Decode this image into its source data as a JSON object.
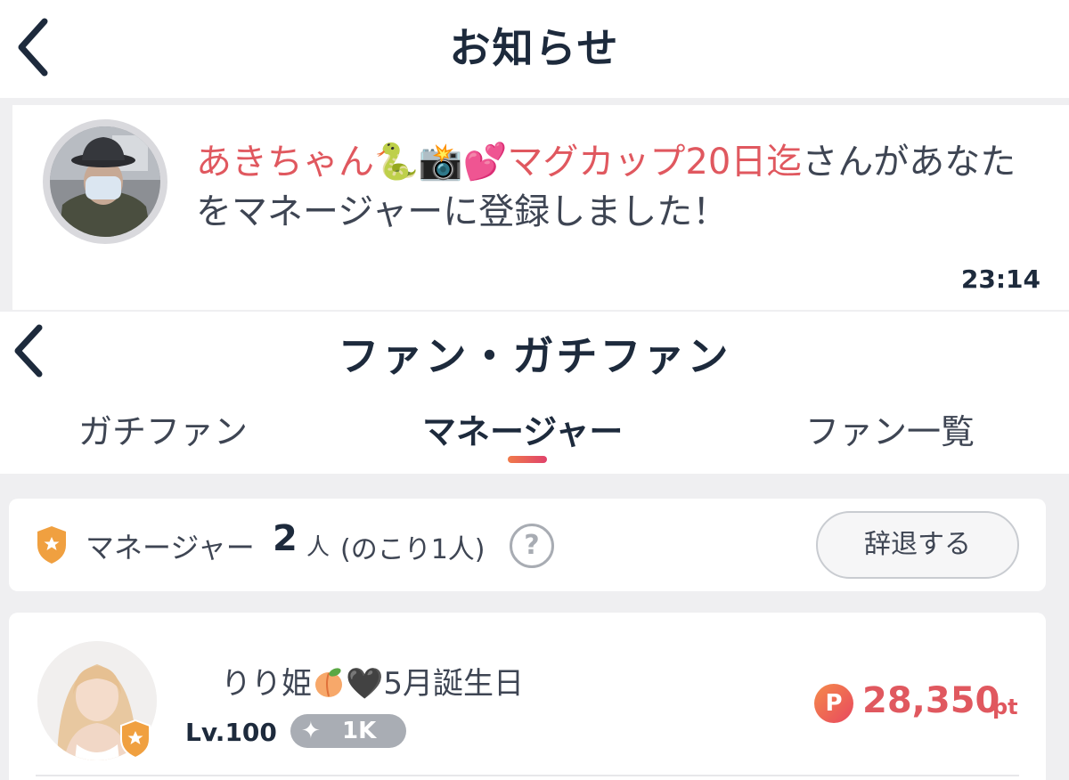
{
  "notifications": {
    "title": "お知らせ",
    "item": {
      "sender_name": "あきちゃん🐍📸💕マグカップ20日迄",
      "message": "さんがあなたをマネージャーに登録しました！",
      "time": "23:14"
    }
  },
  "fan_screen": {
    "title": "ファン・ガチファン",
    "tabs": [
      {
        "label": "ガチファン",
        "active": false
      },
      {
        "label": "マネージャー",
        "active": true
      },
      {
        "label": "ファン一覧",
        "active": false
      }
    ],
    "manager_bar": {
      "label": "マネージャー",
      "count": "2",
      "unit": "人",
      "remaining": "(のこり1人)",
      "help_icon": "?",
      "resign_label": "辞退する"
    },
    "fan": {
      "name_part1": "りり姫",
      "name_part2": "🖤5月誕生日",
      "level": "Lv.100",
      "rank_icon": "✦",
      "rank": "1K",
      "points_icon": "P",
      "points": "28,350",
      "points_unit": "pt"
    }
  },
  "colors": {
    "accent_red": "#e0585f",
    "navy_text": "#1d2a3c",
    "manager_shield": "#f0a040",
    "tab_indicator": [
      "#f07a4a",
      "#e0426b"
    ]
  },
  "icons": [
    "back-chevron-icon",
    "shield-star-icon",
    "help-icon",
    "sparkle-icon",
    "points-p-icon",
    "peach-emoji-icon"
  ]
}
